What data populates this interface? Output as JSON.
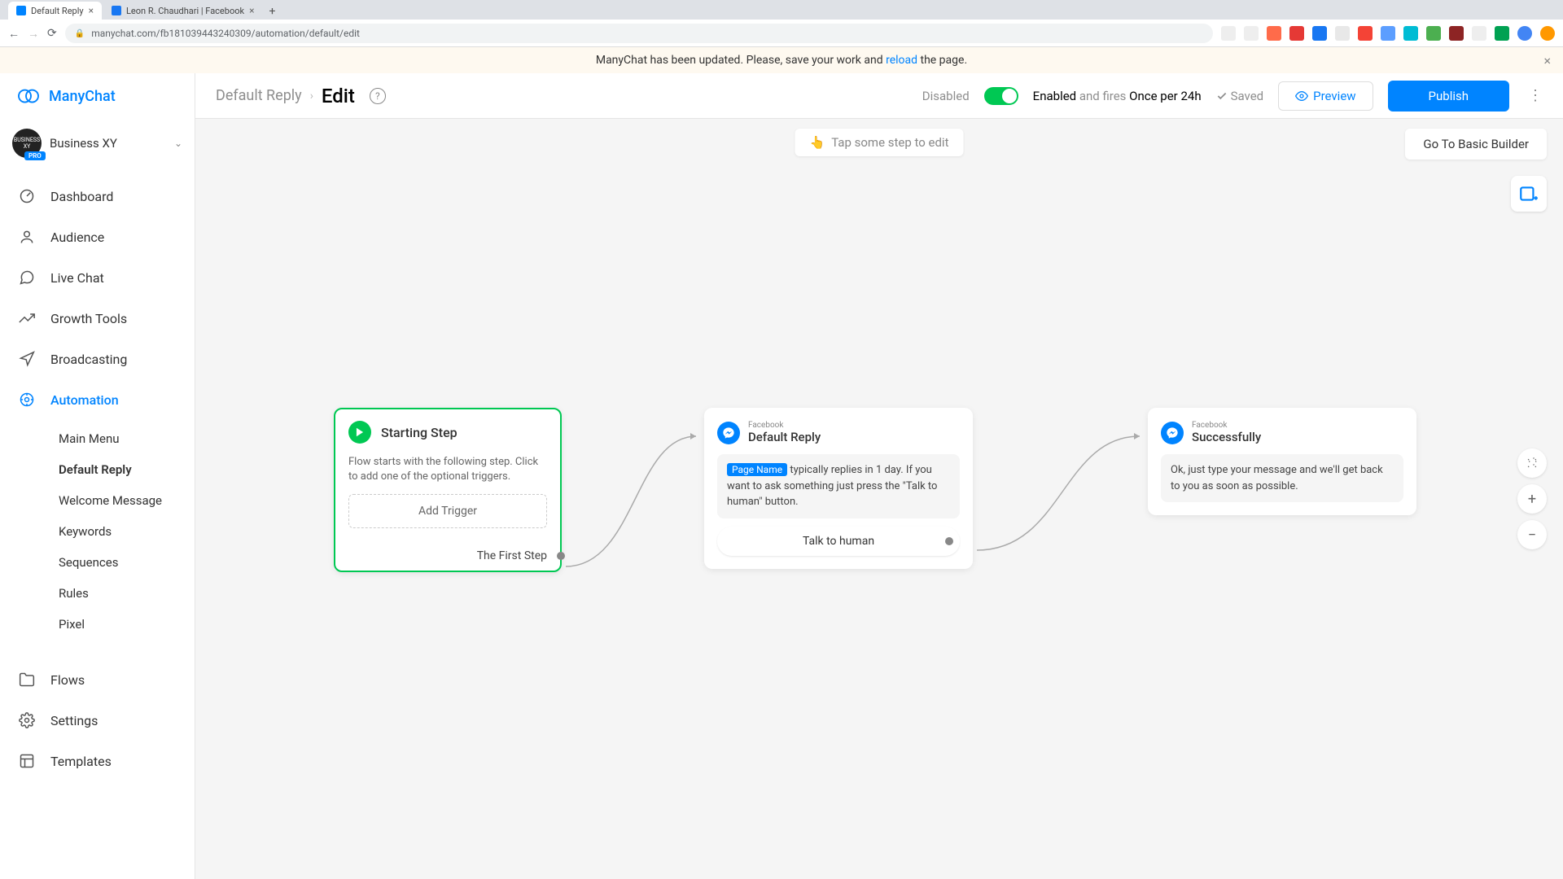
{
  "browser": {
    "tabs": [
      {
        "title": "Default Reply",
        "active": true
      },
      {
        "title": "Leon R. Chaudhari | Facebook",
        "active": false
      }
    ],
    "url": "manychat.com/fb181039443240309/automation/default/edit"
  },
  "banner": {
    "prefix": "ManyChat has been updated. Please, save your work and ",
    "link": "reload",
    "suffix": " the page."
  },
  "header": {
    "breadcrumb_parent": "Default Reply",
    "breadcrumb_current": "Edit",
    "disabled": "Disabled",
    "enabled": "Enabled",
    "fires_grey": " and fires ",
    "fires_bold": "Once per 24h",
    "saved": "Saved",
    "preview": "Preview",
    "publish": "Publish"
  },
  "logo": "ManyChat",
  "account": {
    "name": "Business XY",
    "badge": "PRO"
  },
  "nav": {
    "dashboard": "Dashboard",
    "audience": "Audience",
    "livechat": "Live Chat",
    "growth": "Growth Tools",
    "broadcasting": "Broadcasting",
    "automation": "Automation",
    "flows": "Flows",
    "settings": "Settings",
    "templates": "Templates"
  },
  "subnav": {
    "main_menu": "Main Menu",
    "default_reply": "Default Reply",
    "welcome": "Welcome Message",
    "keywords": "Keywords",
    "sequences": "Sequences",
    "rules": "Rules",
    "pixel": "Pixel"
  },
  "canvas": {
    "tap_hint": "Tap some step to edit",
    "basic_builder": "Go To Basic Builder"
  },
  "nodes": {
    "start": {
      "title": "Starting Step",
      "desc": "Flow starts with the following step. Click to add one of the optional triggers.",
      "add_trigger": "Add Trigger",
      "first_step": "The First Step"
    },
    "reply": {
      "platform": "Facebook",
      "title": "Default Reply",
      "page_tag": "Page Name",
      "body_after_tag": " typically replies in 1 day. If you want to ask something just press the \"Talk to human\" button.",
      "button": "Talk to human"
    },
    "success": {
      "platform": "Facebook",
      "title": "Successfully",
      "body": "Ok, just type your message and we'll get back to you as soon as possible."
    }
  }
}
